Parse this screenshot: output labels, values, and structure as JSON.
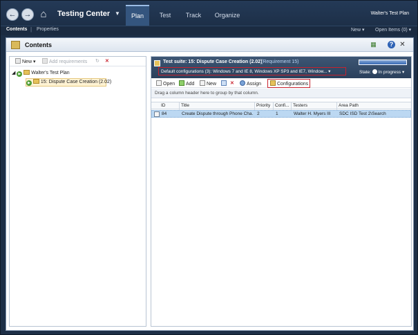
{
  "nav": {
    "back_icon": "back-arrow-icon",
    "forward_icon": "forward-arrow-icon",
    "home_icon": "home-icon",
    "app_title": "Testing Center",
    "tabs": [
      {
        "label": "Plan",
        "active": true
      },
      {
        "label": "Test",
        "active": false
      },
      {
        "label": "Track",
        "active": false
      },
      {
        "label": "Organize",
        "active": false
      }
    ],
    "plan_name": "Walter's Test Plan"
  },
  "subnav": {
    "items": [
      "Contents",
      "Properties"
    ],
    "right": [
      "New ▾",
      "Open Items (0) ▾"
    ]
  },
  "content": {
    "title": "Contents",
    "left_toolbar": {
      "new_label": "New",
      "add_requirements_label": "Add requirements"
    },
    "tree": [
      {
        "label": "Walter's Test Plan",
        "level": 0
      },
      {
        "label": "15: Dispute Case Creation (2.02)",
        "level": 1,
        "selected": true
      }
    ],
    "suite": {
      "title": "Test suite:  15: Dispute Case Creation (2.02)",
      "requirement": "(Requirement 15)",
      "configurations": "Default configurations (3):   Windows 7 and IE 8, Windows XP SP3 and IE7, Window...  ▾",
      "state_label": "State:",
      "state_value": "In progress",
      "progress": 1.0
    },
    "right_toolbar": {
      "open_label": "Open",
      "add_label": "Add",
      "new_label": "New",
      "assign_label": "Assign",
      "configurations_label": "Configurations"
    },
    "group_hint": "Drag a column header here to group by that column.",
    "columns": [
      "ID",
      "Title",
      "Priority",
      "Confi...",
      "Testers",
      "Area Path"
    ],
    "rows": [
      {
        "id": "84",
        "title": "Create Dispute through Phone Cha...",
        "priority": "2",
        "config": "1",
        "testers": "Walter H. Myers III",
        "area_path": "SDC ISD Test 2\\Search"
      }
    ]
  },
  "colors": {
    "chrome": "#1d2f47",
    "accent": "#34557e",
    "highlight_box": "#c8222e",
    "selected_row": "#bcd8f2"
  }
}
